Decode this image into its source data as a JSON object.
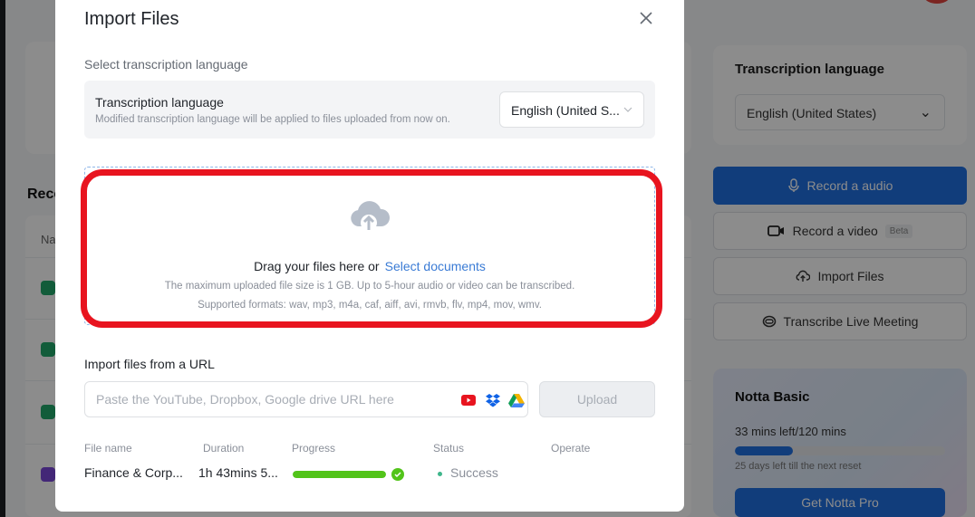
{
  "background": {
    "recent_title": "Rece",
    "table_head": "Na",
    "right_panel": {
      "lang_title": "Transcription language",
      "lang_value": "English (United States)",
      "buttons": [
        {
          "label": "Record a audio",
          "icon": "microphone-icon"
        },
        {
          "label": "Record a video",
          "icon": "video-camera-icon",
          "badge": "Beta"
        },
        {
          "label": "Import Files",
          "icon": "cloud-upload-icon"
        },
        {
          "label": "Transcribe Live Meeting",
          "icon": "meeting-icon"
        }
      ],
      "plan": {
        "title": "Notta Basic",
        "minutes": "33 mins left/120 mins",
        "used_fraction": 0.275,
        "reset": "25 days left till the next reset",
        "cta": "Get Notta Pro"
      }
    }
  },
  "modal": {
    "title": "Import Files",
    "close_icon": "close-icon",
    "language_section_label": "Select transcription language",
    "language_box": {
      "title": "Transcription language",
      "subtitle": "Modified transcription language will be applied to files uploaded from now on.",
      "selected": "English (United S..."
    },
    "dropzone": {
      "icon": "cloud-upload-icon",
      "drag_text": "Drag your files here or",
      "select_link": "Select documents",
      "size_hint": "The maximum uploaded file size is 1 GB. Up to 5-hour audio or video can be transcribed.",
      "formats_hint": "Supported formats: wav, mp3, m4a, caf, aiff, avi, rmvb, flv, mp4, mov, wmv."
    },
    "url_section": {
      "label": "Import files from a URL",
      "placeholder": "Paste the YouTube, Dropbox, Google drive URL here",
      "value": "",
      "service_icons": [
        "youtube-icon",
        "dropbox-icon",
        "google-drive-icon"
      ],
      "upload_label": "Upload"
    },
    "files_table": {
      "columns": [
        "File name",
        "Duration",
        "Progress",
        "Status",
        "Operate"
      ],
      "rows": [
        {
          "file_name": "Finance & Corp...",
          "duration": "1h 43mins 5...",
          "progress": 1.0,
          "status": "Success",
          "operate": ""
        }
      ]
    }
  },
  "colors": {
    "accent": "#3a7bd5",
    "highlight": "#e8141f",
    "success": "#52c41a",
    "primary_button": "#1f6fe0"
  }
}
